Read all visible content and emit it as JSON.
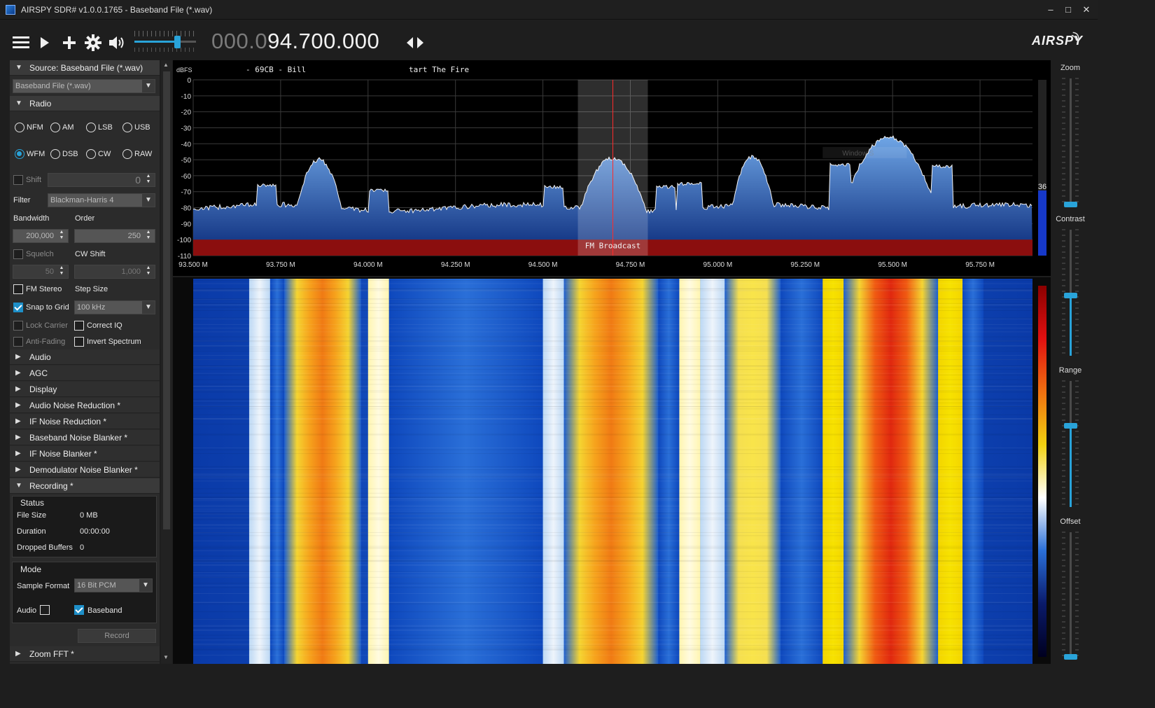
{
  "window": {
    "title": "AIRSPY SDR# v1.0.0.1765 - Baseband File (*.wav)",
    "minimize": "–",
    "maximize": "□",
    "close": "✕"
  },
  "toolbar": {
    "menu_icon": "hamburger-icon",
    "play_icon": "play-icon",
    "add_icon": "plus-icon",
    "settings_icon": "gear-icon",
    "volume_icon": "speaker-icon",
    "volume_level": 0.7,
    "frequency_dim": "000.0",
    "frequency_lit": "94.700.000",
    "tune_icon": "left-right-arrows-icon",
    "logo": "AIRSPY"
  },
  "sidebar": {
    "source": {
      "header": "Source: Baseband File (*.wav)",
      "combo": "Baseband File (*.wav)"
    },
    "radio": {
      "header": "Radio",
      "modes_row1": [
        "NFM",
        "AM",
        "LSB",
        "USB"
      ],
      "modes_row2": [
        "WFM",
        "DSB",
        "CW",
        "RAW"
      ],
      "selected": "WFM",
      "shift_label": "Shift",
      "shift_value": "0",
      "filter_label": "Filter",
      "filter_value": "Blackman-Harris 4",
      "bandwidth_label": "Bandwidth",
      "bandwidth_value": "200,000",
      "order_label": "Order",
      "order_value": "250",
      "squelch_label": "Squelch",
      "squelch_value": "50",
      "cw_shift_label": "CW Shift",
      "cw_shift_value": "1,000",
      "fm_stereo_label": "FM Stereo",
      "step_size_label": "Step Size",
      "snap_label": "Snap to Grid",
      "step_value": "100 kHz",
      "lock_carrier_label": "Lock Carrier",
      "correct_iq_label": "Correct IQ",
      "anti_fading_label": "Anti-Fading",
      "invert_label": "Invert Spectrum"
    },
    "collapsed": [
      "Audio",
      "AGC",
      "Display",
      "Audio Noise Reduction *",
      "IF Noise Reduction *",
      "Baseband Noise Blanker *",
      "IF Noise Blanker *",
      "Demodulator Noise Blanker *"
    ],
    "recording": {
      "header": "Recording *",
      "status_title": "Status",
      "file_size_label": "File Size",
      "file_size": "0 MB",
      "duration_label": "Duration",
      "duration": "00:00:00",
      "dropped_label": "Dropped Buffers",
      "dropped": "0",
      "mode_title": "Mode",
      "format_label": "Sample Format",
      "format_value": "16 Bit PCM",
      "audio_label": "Audio",
      "baseband_label": "Baseband",
      "record_button": "Record"
    },
    "zoom_fft": "Zoom FFT *"
  },
  "spectrum": {
    "ylabel": "dBFS",
    "rds_text": "- 69CB - Bill",
    "rds_radiotext": "tart The Fire",
    "band_label": "FM Broadcast",
    "y_ticks": [
      "0",
      "-10",
      "-20",
      "-30",
      "-40",
      "-50",
      "-60",
      "-70",
      "-80",
      "-90",
      "-100",
      "-110"
    ],
    "x_ticks": [
      "93.500 M",
      "93.750 M",
      "94.000 M",
      "94.250 M",
      "94.500 M",
      "94.750 M",
      "95.000 M",
      "95.250 M",
      "95.500 M",
      "95.750 M"
    ],
    "snr_value": "36",
    "hint_text": "Window S",
    "colors": {
      "fill_top": "#6fa6e6",
      "fill_bottom": "#0a2a7a",
      "band": "#8b0e0e",
      "tuned": "#ff2a2a"
    }
  },
  "rightpanel": {
    "zoom": "Zoom",
    "contrast": "Contrast",
    "range": "Range",
    "offset": "Offset"
  }
}
